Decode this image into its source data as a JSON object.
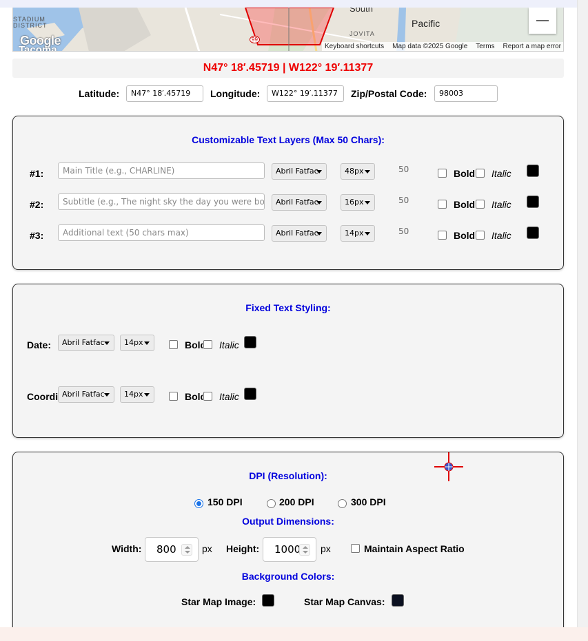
{
  "map": {
    "places": [
      "STADIUM",
      "DISTRICT",
      "South",
      "JOVITA",
      "Pacific",
      "99"
    ],
    "google_logo": "Google",
    "google_logo_partial": "Tacoma",
    "attribution": [
      "Keyboard shortcuts",
      "Map data ©2025 Google",
      "Terms",
      "Report a map error"
    ],
    "zoom_out_icon": "minus-icon"
  },
  "coordinates_display": "N47° 18′.45719 | W122° 19′.11377",
  "location": {
    "latitude_label": "Latitude:",
    "latitude_value": "N47° 18′.45719",
    "longitude_label": "Longitude:",
    "longitude_value": "W122° 19′.11377",
    "zip_label": "Zip/Postal Code:",
    "zip_value": "98003"
  },
  "text_layers": {
    "title": "Customizable Text Layers (Max 50 Chars):",
    "rows": [
      {
        "label": "#1:",
        "placeholder": "Main Title (e.g., CHARLINE)",
        "font": "Abril Fatfac",
        "size": "48px",
        "count": "50",
        "bold": "Bold",
        "italic": "Italic"
      },
      {
        "label": "#2:",
        "placeholder": "Subtitle (e.g., The night sky the day you were born)",
        "font": "Abril Fatfac",
        "size": "16px",
        "count": "50",
        "bold": "Bold",
        "italic": "Italic"
      },
      {
        "label": "#3:",
        "placeholder": "Additional text (50 chars max)",
        "font": "Abril Fatfac",
        "size": "14px",
        "count": "50",
        "bold": "Bold",
        "italic": "Italic"
      }
    ]
  },
  "fixed_text": {
    "title": "Fixed Text Styling:",
    "rows": [
      {
        "label": "Date:",
        "font": "Abril Fatfac",
        "size": "14px",
        "bold": "Bold",
        "italic": "Italic"
      },
      {
        "label": "Coordinates:",
        "font": "Abril Fatfac",
        "size": "14px",
        "bold": "Bold",
        "italic": "Italic"
      }
    ]
  },
  "output": {
    "dpi_title": "DPI (Resolution):",
    "dpi_options": [
      "150 DPI",
      "200 DPI",
      "300 DPI"
    ],
    "dpi_selected": "150 DPI",
    "dimensions_title": "Output Dimensions:",
    "width_label": "Width:",
    "width_value": "800",
    "height_label": "Height:",
    "height_value": "1000",
    "unit": "px",
    "aspect_label": "Maintain Aspect Ratio",
    "bg_title": "Background Colors:",
    "star_map_image_label": "Star Map Image:",
    "star_map_canvas_label": "Star Map Canvas:"
  },
  "colors": {
    "coord_text": "#ee0000",
    "section_title": "#0000dd",
    "swatch": "#000000",
    "canvas_swatch": "#0b1020"
  }
}
